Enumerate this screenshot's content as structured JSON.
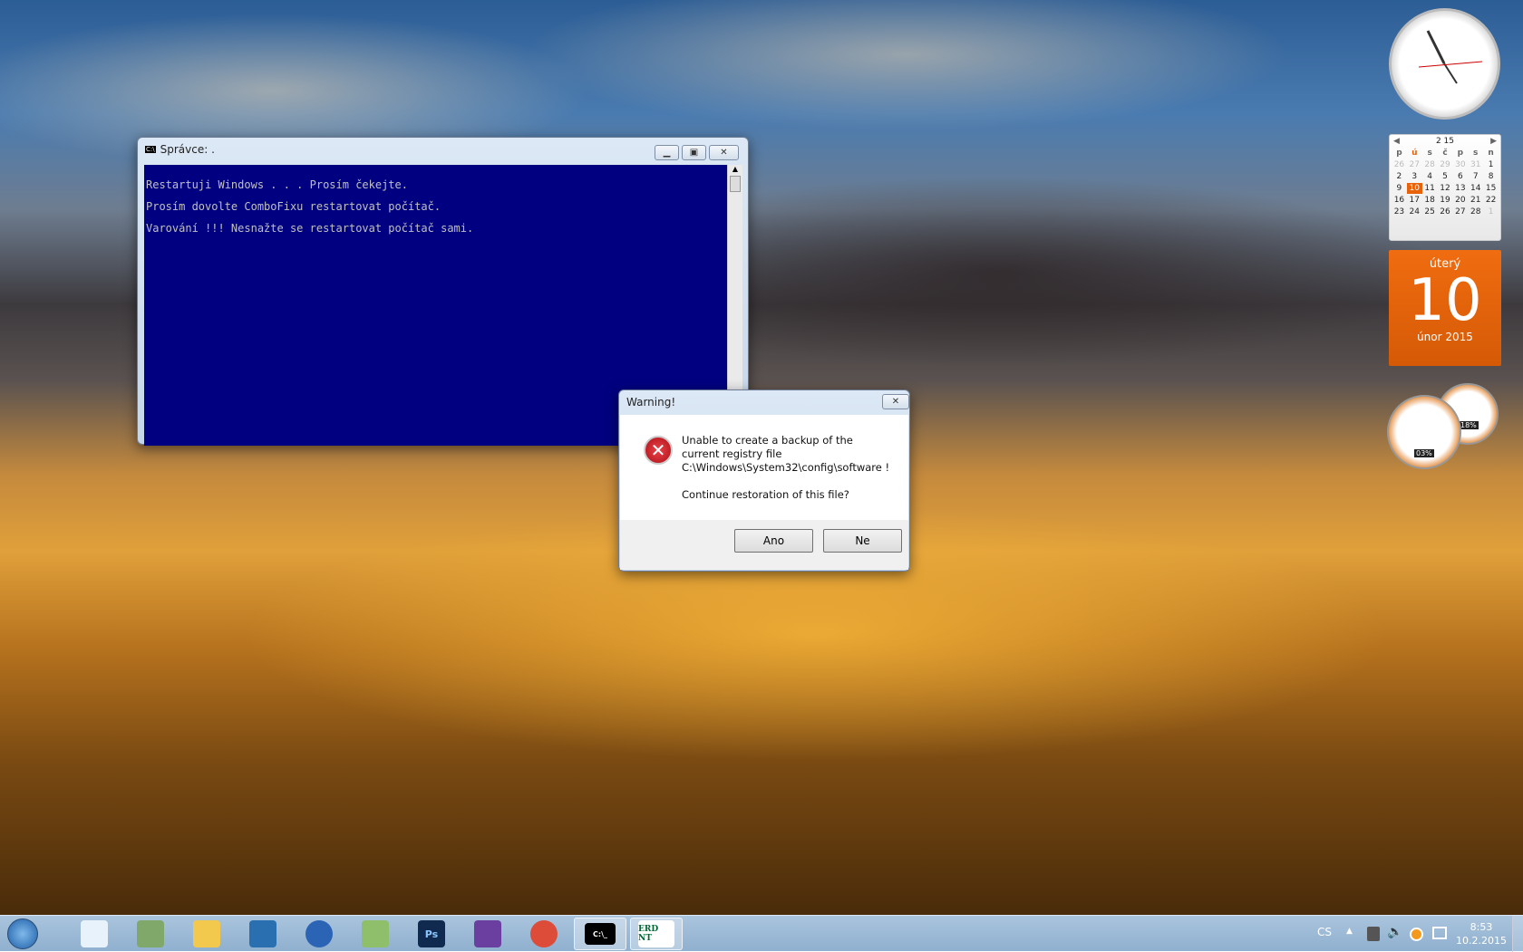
{
  "console": {
    "title": "Správce: .",
    "lines": [
      "Restartuji Windows . . . Prosím čekejte.",
      "Prosím dovolte ComboFixu restartovat počítač.",
      "Varování !!! Nesnažte se restartovat počítač sami."
    ]
  },
  "dialog": {
    "title": "Warning!",
    "lines": [
      "Unable to create a backup of the",
      "current registry file",
      "C:\\Windows\\System32\\config\\software !"
    ],
    "question": "Continue restoration of this file?",
    "yes": "Ano",
    "no": "Ne"
  },
  "calendar": {
    "header": "2 15",
    "days": [
      "p",
      "ú",
      "s",
      "č",
      "p",
      "s",
      "n"
    ],
    "weeks": [
      [
        "26",
        "27",
        "28",
        "29",
        "30",
        "31",
        "1"
      ],
      [
        "2",
        "3",
        "4",
        "5",
        "6",
        "7",
        "8"
      ],
      [
        "9",
        "10",
        "11",
        "12",
        "13",
        "14",
        "15"
      ],
      [
        "16",
        "17",
        "18",
        "19",
        "20",
        "21",
        "22"
      ],
      [
        "23",
        "24",
        "25",
        "26",
        "27",
        "28",
        "1"
      ]
    ],
    "weekday": "úterý",
    "day": "10",
    "month_year": "únor 2015",
    "accent": "#e8620a"
  },
  "meters": {
    "cpu": "03%",
    "memory": "18%"
  },
  "taskbar": {
    "apps": [
      "start",
      "snipping-tool",
      "network-tool",
      "file-explorer",
      "notes",
      "google-earth",
      "image-viewer",
      "photoshop",
      "visual-studio",
      "chrome",
      "command-prompt",
      "erd-commander"
    ],
    "ps_label": "Ps",
    "erd_label": "ERD NT",
    "cmd_label": "C:\\_",
    "lang": "CS",
    "time": "8:53",
    "date": "10.2.2015"
  }
}
